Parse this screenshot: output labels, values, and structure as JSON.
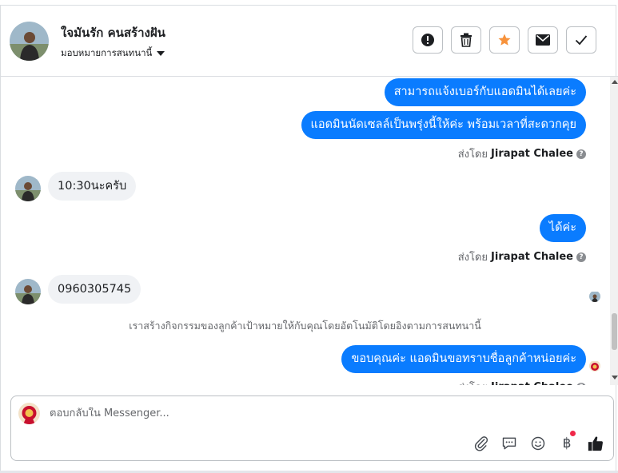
{
  "header": {
    "contact_name": "ใจมันรัก คนสร้างฝัน",
    "assign_label": "มอบหมายการสนทนานี้",
    "actions": [
      {
        "name": "mark-spam",
        "icon": "alert-circle-icon"
      },
      {
        "name": "delete",
        "icon": "trash-icon"
      },
      {
        "name": "star",
        "icon": "star-icon"
      },
      {
        "name": "mark-unread",
        "icon": "envelope-icon"
      },
      {
        "name": "mark-done",
        "icon": "check-icon"
      }
    ]
  },
  "messages": {
    "m1": "สามารถแจ้งเบอร์กับแอดมินได้เลยค่ะ",
    "m2": "แอดมินนัดเซลล์เป็นพรุ่งนี้ให้ค่ะ พร้อมเวลาที่สะดวกคุย",
    "sent_by_prefix": "ส่งโดย",
    "sent_by_name": "Jirapat Chalee",
    "m3": "10:30นะครับ",
    "m4": "ได้ค่ะ",
    "m5": "0960305745",
    "system_note": "เราสร้างกิจกรรมของลูกค้าเป้าหมายให้กับคุณโดยอัตโนมัติโดยอิงตามการสนทนานี้",
    "m6": "ขอบคุณค่ะ แอดมินขอทราบชื่อลูกค้าหน่อยค่ะ"
  },
  "composer": {
    "placeholder": "ตอบกลับใน Messenger...",
    "tools": [
      "paperclip-icon",
      "chat-bubble-icon",
      "smiley-icon",
      "baht-icon",
      "thumbs-up-icon"
    ]
  },
  "colors": {
    "outgoing_bubble": "#0a7cff",
    "incoming_bubble": "#f0f2f5",
    "star": "#f7923b",
    "notification_dot": "#f02849"
  }
}
